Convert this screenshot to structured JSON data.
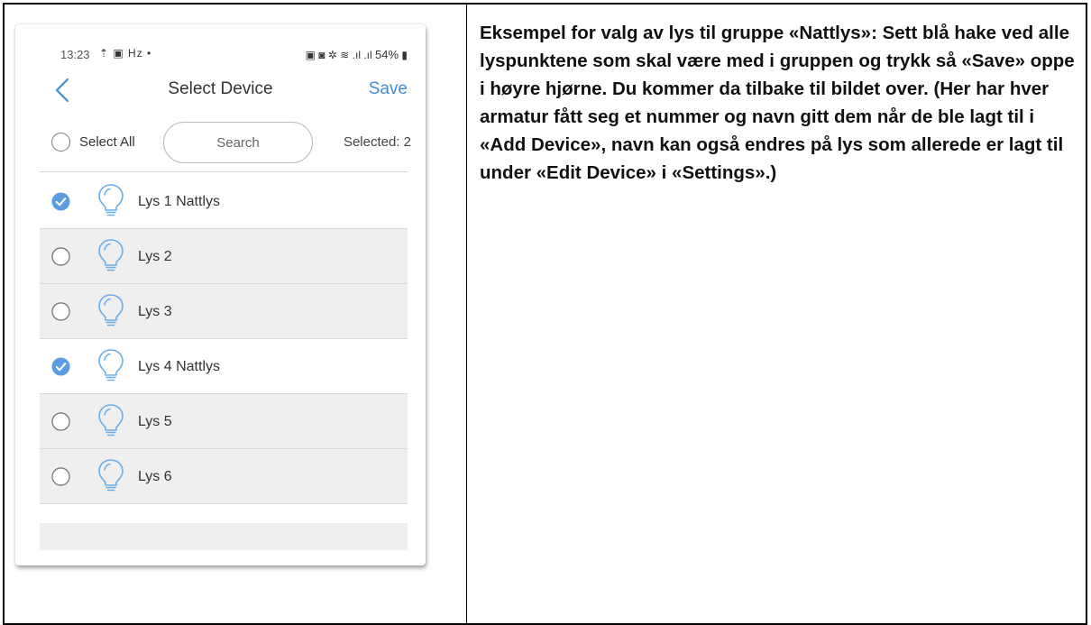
{
  "status_bar": {
    "time": "13:23",
    "left_icons": "⇡ ▣ Hᴢ •",
    "right_icons": "▣ ◙ ✲ ≋ .ıl .ıl",
    "battery": "54%"
  },
  "nav": {
    "title": "Select Device",
    "save_label": "Save"
  },
  "toolbar": {
    "select_all_label": "Select All",
    "search_placeholder": "Search",
    "selected_text": "Selected: 2"
  },
  "devices": [
    {
      "label": "Lys 1 Nattlys",
      "checked": true
    },
    {
      "label": "Lys 2",
      "checked": false
    },
    {
      "label": "Lys 3",
      "checked": false
    },
    {
      "label": "Lys 4 Nattlys",
      "checked": true
    },
    {
      "label": "Lys 5",
      "checked": false
    },
    {
      "label": "Lys 6",
      "checked": false
    }
  ],
  "colors": {
    "accent": "#3f8ed8",
    "check_fill": "#5b9de0",
    "bulb": "#6aaee8",
    "row_unchecked_bg": "#efefef"
  },
  "icons": {
    "back": "chevron-left-icon",
    "checked": "check-circle-icon",
    "unchecked": "radio-empty-icon",
    "bulb": "lightbulb-icon"
  },
  "description": "Eksempel for valg av lys til gruppe «Nattlys»: Sett blå hake ved alle lyspunktene som skal være med i gruppen og trykk så «Save» oppe i høyre hjørne. Du kommer da tilbake til bildet over. (Her har hver armatur fått seg et nummer og navn gitt dem når de ble lagt til i «Add Device», navn kan også endres på lys som allerede er lagt til under «Edit Device» i «Settings».)"
}
